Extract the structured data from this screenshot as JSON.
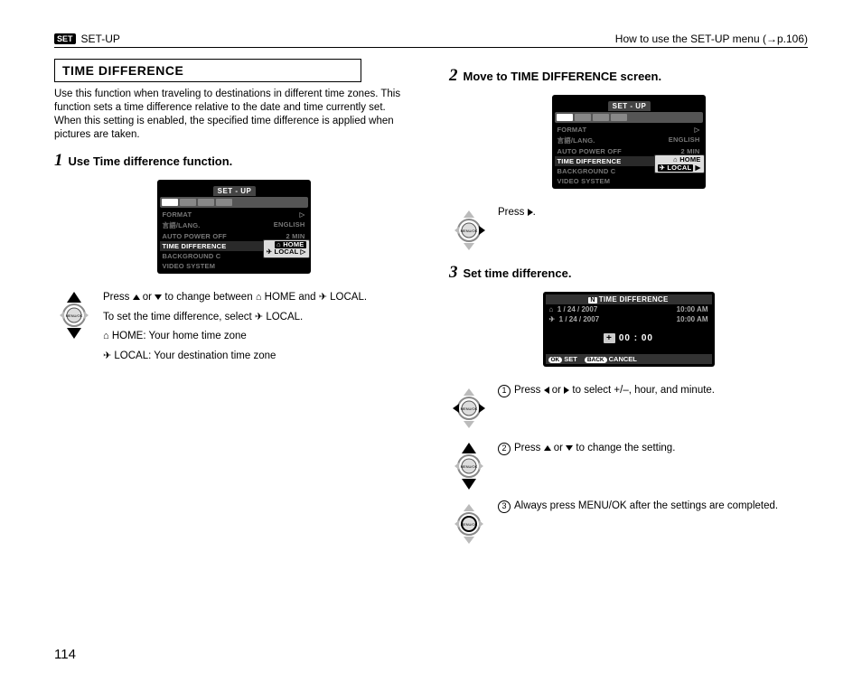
{
  "header": {
    "badge": "SET",
    "left": "SET-UP",
    "right_prefix": "How to use the SET-UP menu (",
    "right_arrow": "→",
    "right_page": "p.106)",
    "right_full": "How to use the SET-UP menu (→p.106)"
  },
  "section_title": "TIME DIFFERENCE",
  "intro": "Use this function when traveling to destinations in different time zones. This function sets a time difference relative to the date and time currently set. When this setting is enabled, the specified time difference is applied when pictures are taken.",
  "step1": {
    "num": "1",
    "title": "Use Time difference function.",
    "lcd": {
      "tab": "SET - UP",
      "rows": [
        {
          "l": "FORMAT",
          "r": "▷"
        },
        {
          "l": "言語/LANG.",
          "r": "ENGLISH"
        },
        {
          "l": "AUTO POWER OFF",
          "r": "2 MIN"
        },
        {
          "l": "TIME DIFFERENCE",
          "r": "",
          "hl": true
        },
        {
          "l": "BACKGROUND C",
          "r": ""
        },
        {
          "l": "VIDEO SYSTEM",
          "r": ""
        }
      ],
      "popup": {
        "home": "HOME",
        "local": "LOCAL",
        "arrow": "▷"
      }
    },
    "instr": {
      "l1a": "Press ",
      "l1b": " or ",
      "l1c": " to change between ",
      "l1_home": " HOME and ",
      "l1_local": " LOCAL.",
      "l2a": "To set the time difference, select ",
      "l2b": " LOCAL.",
      "l3": " HOME: Your home time zone",
      "l4": " LOCAL: Your destination time zone"
    }
  },
  "step2": {
    "num": "2",
    "title": "Move to TIME DIFFERENCE screen.",
    "lcd": {
      "tab": "SET - UP",
      "rows": [
        {
          "l": "FORMAT",
          "r": "▷"
        },
        {
          "l": "言語/LANG.",
          "r": "ENGLISH"
        },
        {
          "l": "AUTO POWER OFF",
          "r": "2 MIN"
        },
        {
          "l": "TIME DIFFERENCE",
          "r": "",
          "hl": true
        },
        {
          "l": "BACKGROUND C",
          "r": ""
        },
        {
          "l": "VIDEO SYSTEM",
          "r": ""
        }
      ],
      "popup": {
        "home": "HOME",
        "local": "LOCAL",
        "arrow": "▶"
      }
    },
    "instr": {
      "press": "Press ",
      "period": "."
    }
  },
  "step3": {
    "num": "3",
    "title": "Set time difference.",
    "lcd": {
      "title_badge": "N",
      "title": "TIME DIFFERENCE",
      "row1": {
        "date": "1 / 24 / 2007",
        "time": "10:00 AM"
      },
      "row2": {
        "date": "1 / 24 / 2007",
        "time": "10:00 AM"
      },
      "body_sign": "+",
      "body_val": "00  :  00",
      "foot_ok": "OK",
      "foot_set": "SET",
      "foot_back": "BACK",
      "foot_cancel": "CANCEL"
    },
    "sub1": {
      "n": "1",
      "a": "Press ",
      "b": " or ",
      "c": " to select +/–, hour, and minute."
    },
    "sub2": {
      "n": "2",
      "a": "Press ",
      "b": " or ",
      "c": " to change the setting."
    },
    "sub3": {
      "n": "3",
      "a": "Always press MENU/OK after the settings are completed."
    }
  },
  "page_number": "114"
}
